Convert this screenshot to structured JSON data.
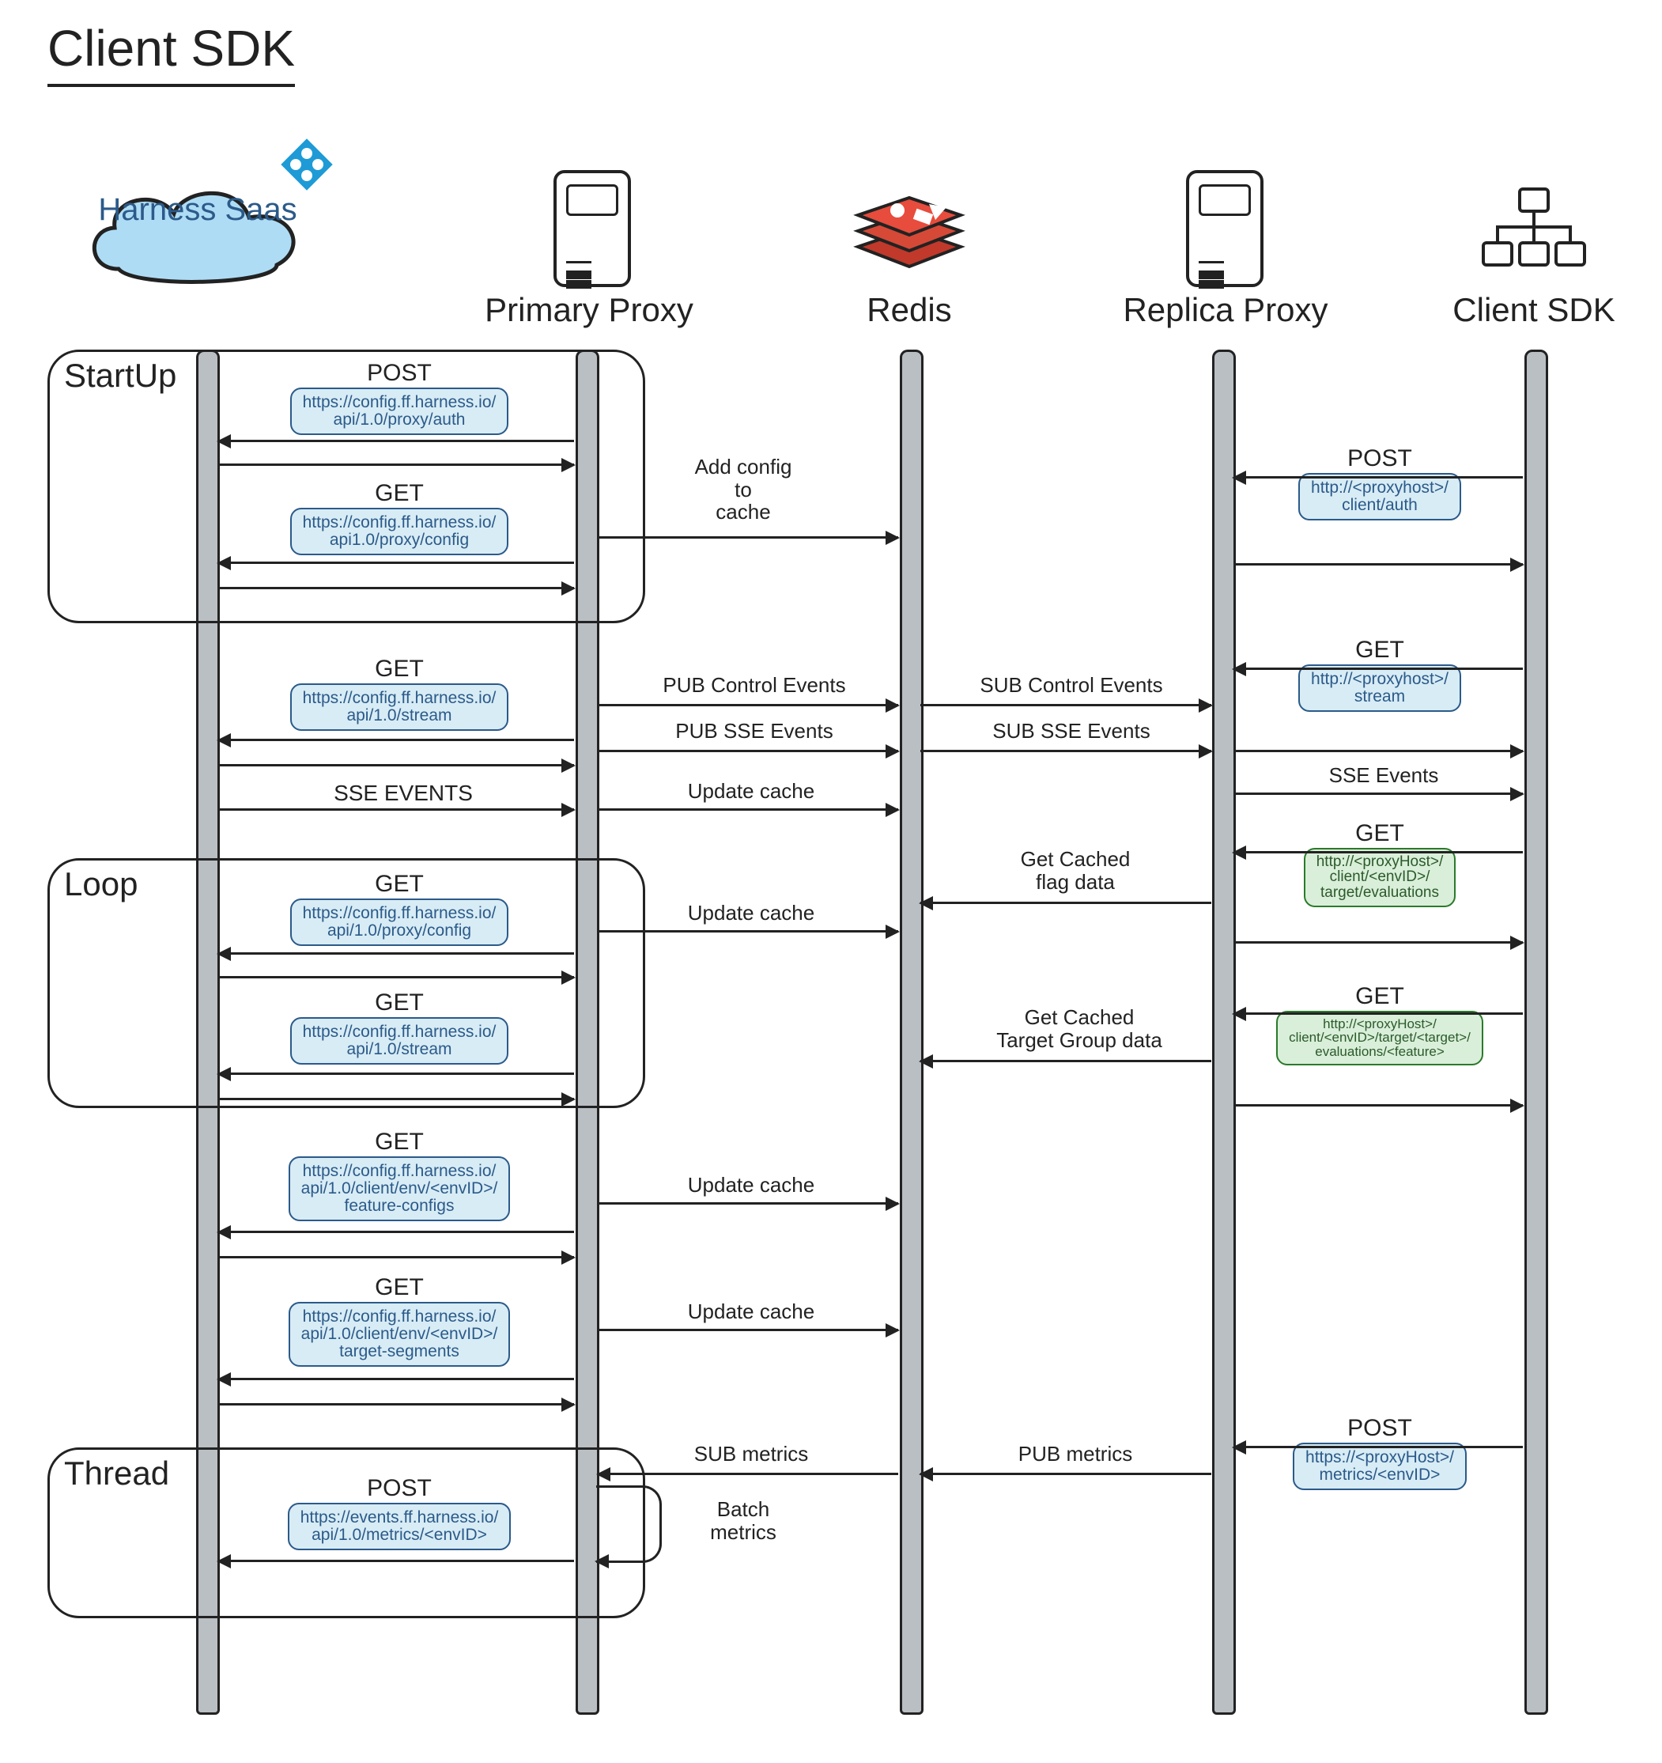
{
  "title": "Client SDK",
  "participants": {
    "saas": {
      "label": "Harness\nSaas"
    },
    "primary": {
      "label": "Primary Proxy"
    },
    "redis": {
      "label": "Redis"
    },
    "replica": {
      "label": "Replica Proxy"
    },
    "client": {
      "label": "Client SDK"
    }
  },
  "groups": {
    "startup": "StartUp",
    "loop": "Loop",
    "thread": "Thread"
  },
  "left_msgs": {
    "post_auth": {
      "method": "POST",
      "url": "https://config.ff.harness.io/\napi/1.0/proxy/auth"
    },
    "get_config_1": {
      "method": "GET",
      "url": "https://config.ff.harness.io/\napi1.0/proxy/config"
    },
    "get_stream_1": {
      "method": "GET",
      "url": "https://config.ff.harness.io/\napi/1.0/stream"
    },
    "sse_events": {
      "method": "",
      "url": "SSE EVENTS"
    },
    "get_config_2": {
      "method": "GET",
      "url": "https://config.ff.harness.io/\napi/1.0/proxy/config"
    },
    "get_stream_2": {
      "method": "GET",
      "url": "https://config.ff.harness.io/\napi/1.0/stream"
    },
    "get_feature_cfg": {
      "method": "GET",
      "url": "https://config.ff.harness.io/\napi/1.0/client/env/<envID>/\nfeature-configs"
    },
    "get_target_seg": {
      "method": "GET",
      "url": "https://config.ff.harness.io/\napi/1.0/client/env/<envID>/\ntarget-segments"
    },
    "post_metrics": {
      "method": "POST",
      "url": "https://events.ff.harness.io/\napi/1.0/metrics/<envID>"
    }
  },
  "mid_labels": {
    "add_config": "Add config\nto\ncache",
    "pub_control": "PUB Control Events",
    "pub_sse": "PUB SSE Events",
    "update_cache": "Update cache",
    "update_cache2": "Update cache",
    "update_cache3": "Update cache",
    "update_cache4": "Update cache",
    "sub_metrics": "SUB metrics",
    "batch": "Batch\nmetrics"
  },
  "right_mid_labels": {
    "sub_control": "SUB Control Events",
    "sub_sse": "SUB SSE Events",
    "get_flag": "Get Cached\nflag data",
    "get_target_grp": "Get Cached\nTarget Group data",
    "pub_metrics": "PUB metrics"
  },
  "right_msgs": {
    "post_auth": {
      "method": "POST",
      "url": "http://<proxyhost>/\nclient/auth"
    },
    "get_stream": {
      "method": "GET",
      "url": "http://<proxyhost>/\nstream"
    },
    "sse": {
      "method": "",
      "url": "SSE Events"
    },
    "get_eval": {
      "method": "GET",
      "url": "http://<proxyHost>/\nclient/<envID>/\ntarget/evaluations"
    },
    "get_eval_one": {
      "method": "GET",
      "url": "http://<proxyHost>/\nclient/<envID>/target/<target>/\nevaluations/<feature>"
    },
    "post_metrics": {
      "method": "POST",
      "url": "https://<proxyHost>/\nmetrics/<envID>"
    }
  }
}
